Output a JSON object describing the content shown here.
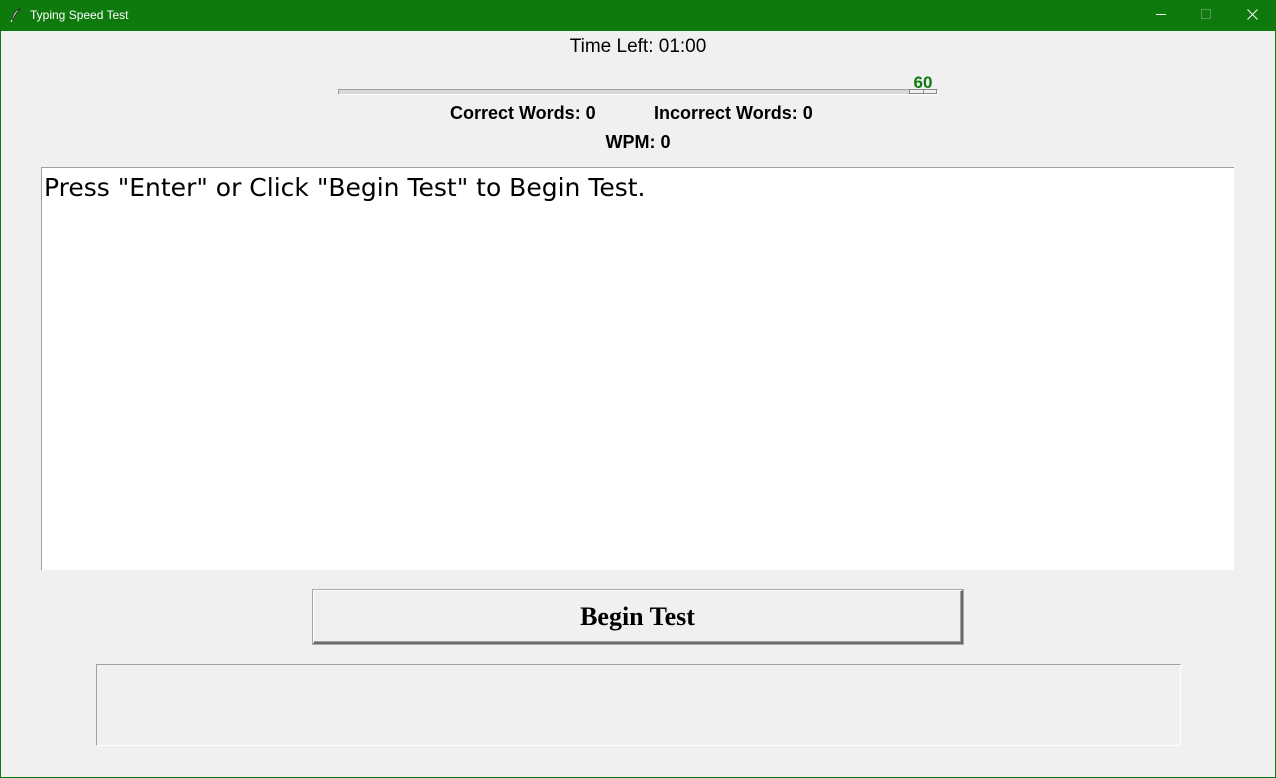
{
  "window": {
    "title": "Typing Speed Test",
    "accent_color": "#0e7a0d",
    "app_icon": "feather-icon",
    "controls": [
      "minimize-icon",
      "maximize-icon",
      "close-icon"
    ]
  },
  "timer": {
    "time_left_label": "Time Left: 01:00"
  },
  "slider": {
    "value_label": "60",
    "value_color": "#0e7a0d",
    "level_fraction": 1.0
  },
  "stats": {
    "correct_words": "Correct Words: 0",
    "incorrect_words": "Incorrect Words: 0",
    "wpm": "WPM: 0"
  },
  "text_area": {
    "content": "Press \"Enter\" or Click \"Begin Test\" to Begin Test."
  },
  "actions": {
    "begin_label": "Begin Test"
  },
  "entry": {
    "value": ""
  }
}
